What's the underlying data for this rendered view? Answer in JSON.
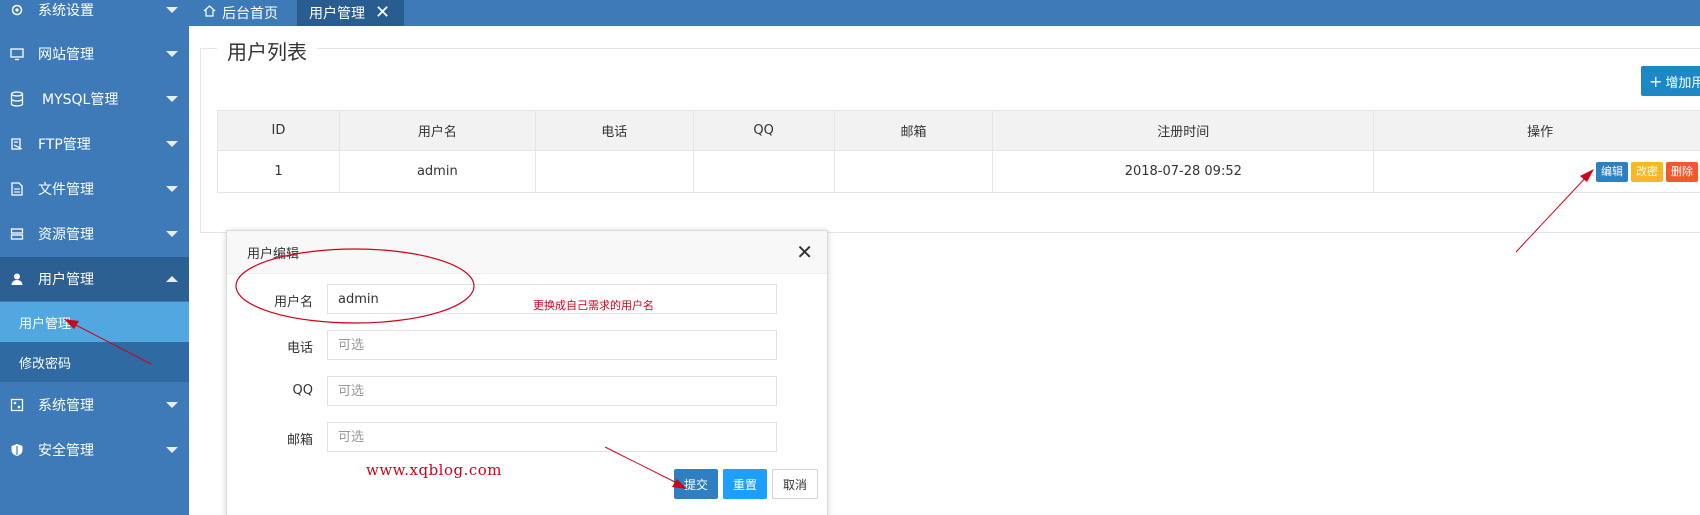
{
  "sidebar": {
    "items": [
      {
        "label": "系统设置",
        "icon": "gear-icon"
      },
      {
        "label": "网站管理",
        "icon": "monitor-icon"
      },
      {
        "label": "MYSQL管理",
        "icon": "database-icon"
      },
      {
        "label": "FTP管理",
        "icon": "ftp-icon"
      },
      {
        "label": "文件管理",
        "icon": "file-icon"
      },
      {
        "label": "资源管理",
        "icon": "server-icon"
      },
      {
        "label": "用户管理",
        "icon": "user-icon",
        "expanded": true
      },
      {
        "label": "系统管理",
        "icon": "system-icon"
      },
      {
        "label": "安全管理",
        "icon": "shield-icon"
      }
    ],
    "subitems": [
      {
        "label": "用户管理",
        "selected": true
      },
      {
        "label": "修改密码",
        "selected": false
      }
    ]
  },
  "tabs": {
    "home": "后台首页",
    "active": "用户管理"
  },
  "panel": {
    "title": "用户列表",
    "add_button": "增加用"
  },
  "table": {
    "headers": [
      "ID",
      "用户名",
      "电话",
      "QQ",
      "邮箱",
      "注册时间",
      "操作"
    ],
    "rows": [
      {
        "id": "1",
        "username": "admin",
        "phone": "",
        "qq": "",
        "email": "",
        "registered": "2018-07-28 09:52"
      }
    ],
    "actions": {
      "edit": "编辑",
      "password": "改密",
      "delete": "删除"
    }
  },
  "dialog": {
    "title": "用户编辑",
    "fields": [
      {
        "label": "用户名",
        "value": "admin",
        "placeholder": ""
      },
      {
        "label": "电话",
        "value": "",
        "placeholder": "可选"
      },
      {
        "label": "QQ",
        "value": "",
        "placeholder": "可选"
      },
      {
        "label": "邮箱",
        "value": "",
        "placeholder": "可选"
      }
    ],
    "buttons": {
      "submit": "提交",
      "reset": "重置",
      "cancel": "取消"
    }
  },
  "annotations": {
    "hint": "更换成自己需求的用户名",
    "watermark": "www.xqblog.com",
    "color": "#d0021b"
  },
  "colors": {
    "sidebar": "#3d7ab7",
    "sidebar_active": "#2c5f92",
    "subitem_selected": "#51a7e0",
    "edit": "#2e80c2",
    "password": "#f7b824",
    "delete": "#f2582e"
  }
}
